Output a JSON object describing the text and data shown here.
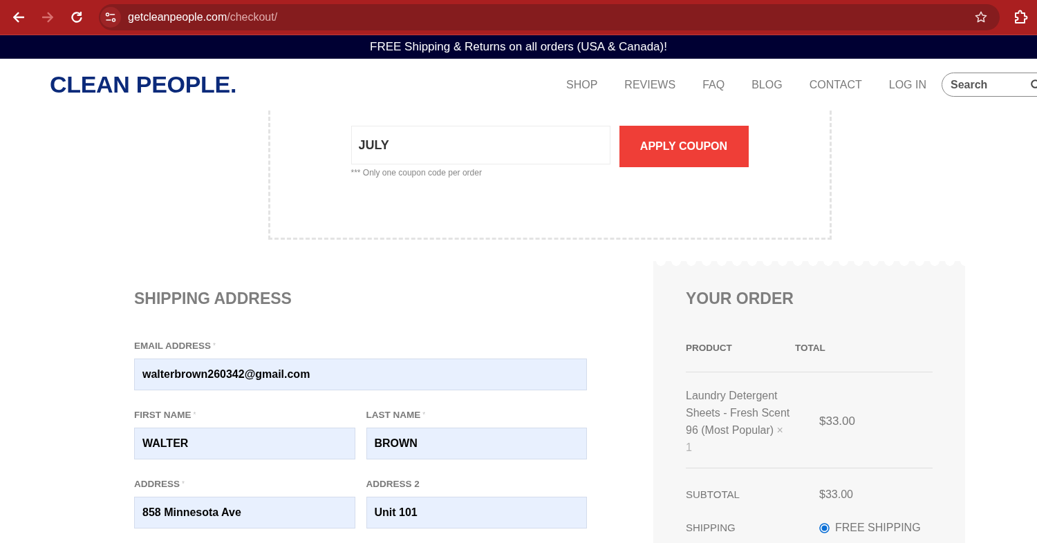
{
  "browser": {
    "nav_buttons": [
      {
        "kind": "back",
        "disabled": false
      },
      {
        "kind": "forward",
        "disabled": true
      },
      {
        "kind": "reload",
        "disabled": false
      }
    ],
    "url_domain": "getcleanpeople.com",
    "url_path": "/checkout/"
  },
  "announcement": "FREE Shipping & Returns on all orders (USA & Canada)!",
  "header": {
    "logo": "CLEAN PEOPLE.",
    "nav": [
      "SHOP",
      "REVIEWS",
      "FAQ",
      "BLOG",
      "CONTACT",
      "LOG IN"
    ],
    "search": {
      "placeholder": "Search"
    }
  },
  "coupon": {
    "value": "JULY",
    "button": "APPLY COUPON",
    "note": "*** Only one coupon code per order"
  },
  "shipping_address": {
    "title": "SHIPPING ADDRESS",
    "rows": [
      [
        {
          "label": "EMAIL ADDRESS",
          "required_mark": "*",
          "value": "walterbrown260342@gmail.com"
        }
      ],
      [
        {
          "label": "FIRST NAME",
          "required_mark": "*",
          "value": "WALTER"
        },
        {
          "label": "LAST NAME",
          "required_mark": "*",
          "value": "BROWN"
        }
      ],
      [
        {
          "label": "ADDRESS",
          "required_mark": "*",
          "value": "858 Minnesota Ave"
        },
        {
          "label": "ADDRESS 2",
          "value": "Unit 101"
        }
      ]
    ]
  },
  "order": {
    "title": "YOUR ORDER",
    "columns": [
      "PRODUCT",
      "TOTAL"
    ],
    "items": [
      {
        "name": "Laundry Detergent Sheets - Fresh Scent 96 (Most Popular)",
        "quantity": "× 1",
        "total": "$33.00"
      }
    ],
    "subtotal": {
      "label": "SUBTOTAL",
      "value": "$33.00"
    },
    "shipping": {
      "label": "SHIPPING",
      "options": [
        {
          "label": "FREE SHIPPING",
          "selected": true
        }
      ]
    }
  }
}
